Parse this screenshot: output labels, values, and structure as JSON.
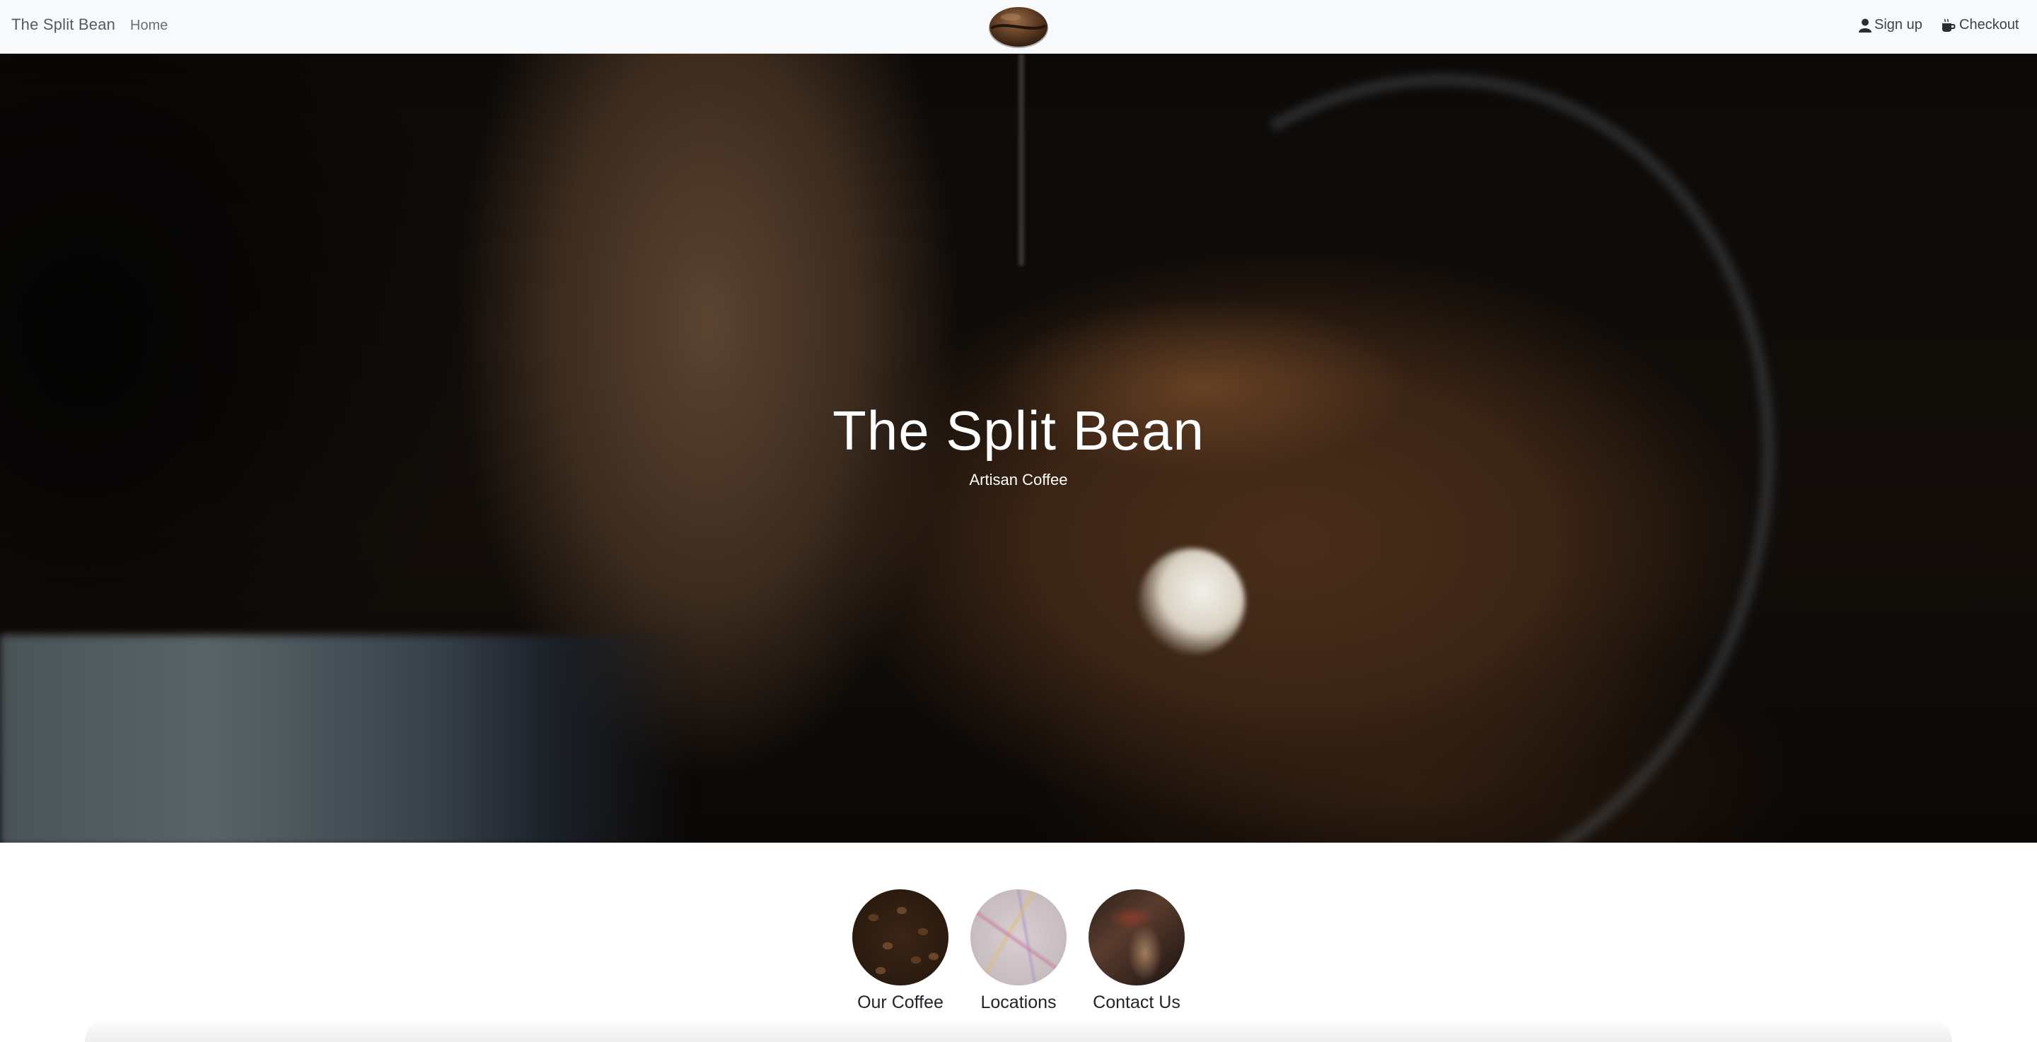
{
  "navbar": {
    "brand": "The Split Bean",
    "home_label": "Home",
    "logo_icon": "coffee-bean-logo",
    "signup_label": "Sign up",
    "signup_icon": "user-icon",
    "checkout_label": "Checkout",
    "checkout_icon": "coffee-cup-icon"
  },
  "hero": {
    "title": "The Split Bean",
    "subtitle": "Artisan Coffee"
  },
  "features": [
    {
      "label": "Our Coffee",
      "icon": "coffee-beans-image"
    },
    {
      "label": "Locations",
      "icon": "map-image"
    },
    {
      "label": "Contact Us",
      "icon": "contact-image"
    }
  ],
  "colors": {
    "navbar_bg": "#f8f9fa",
    "text_dark": "#212529",
    "hero_text": "#ffffff"
  }
}
